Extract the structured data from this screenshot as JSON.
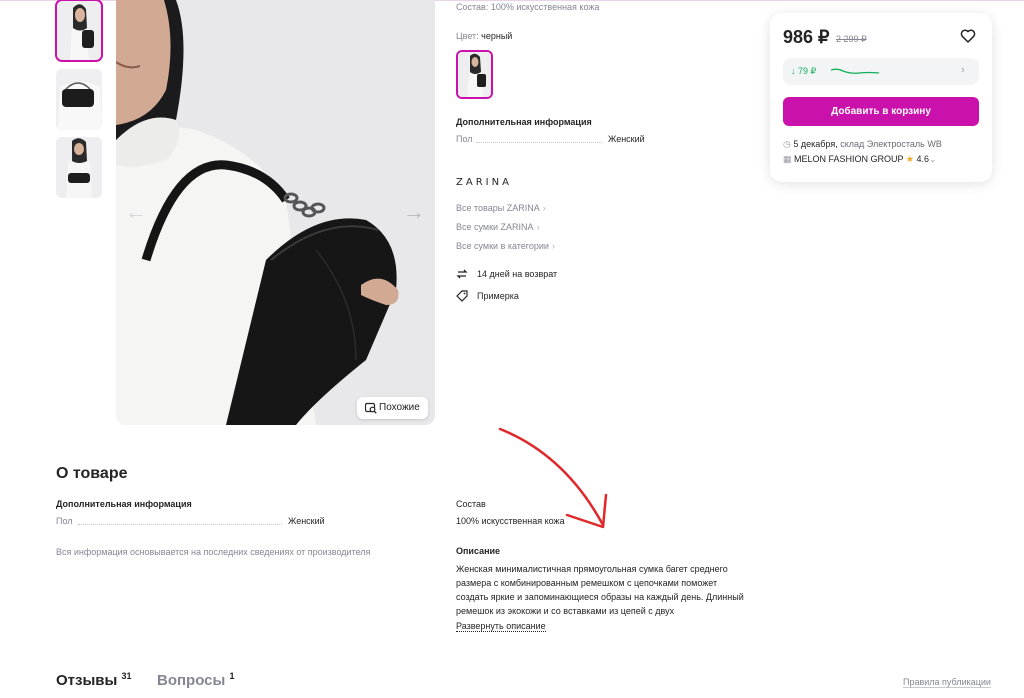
{
  "product": {
    "composition_line": "Состав: 100% искусственная кожа",
    "color_label": "Цвет: ",
    "color_value": "черный",
    "extra_info_title": "Дополнительная информация",
    "gender_label": "Пол",
    "gender_value": "Женский",
    "brand": "ZARINA",
    "brand_links": [
      "Все товары ZARINA",
      "Все сумки ZARINA",
      "Все сумки в категории"
    ],
    "features": [
      "14 дней на возврат",
      "Примерка"
    ],
    "similar_button": "Похожие"
  },
  "price_card": {
    "price": "986 ₽",
    "old_price": "2 299 ₽",
    "price_history": "↓ 79 ₽",
    "add_to_cart": "Добавить в корзину",
    "delivery_date": "5 декабря,",
    "warehouse": "склад Электросталь WB",
    "seller": "MELON FASHION GROUP",
    "rating": "4.6"
  },
  "about": {
    "title": "О товаре",
    "extra_info_title": "Дополнительная информация",
    "gender_label": "Пол",
    "gender_value": "Женский",
    "disclaimer": "Вся информация основывается на последних сведениях от производителя",
    "composition_title": "Состав",
    "composition_value": "100% искусственная кожа",
    "description_title": "Описание",
    "description_text": "Женская минималистичная прямоугольная сумка багет среднего размера с комбинированным ремешком с цепочками поможет создать яркие и запоминающиеся образы на каждый день. Длинный ремешок из экокожи и со вставками из цепей с двух",
    "expand_link": "Развернуть описание"
  },
  "tabs": {
    "reviews_label": "Отзывы",
    "reviews_count": "31",
    "questions_label": "Вопросы",
    "questions_count": "1",
    "rules_link": "Правила публикации"
  },
  "colors": {
    "accent": "#cb11ab",
    "price_drop": "#14b05a",
    "annotation_arrow": "#e0282a"
  }
}
